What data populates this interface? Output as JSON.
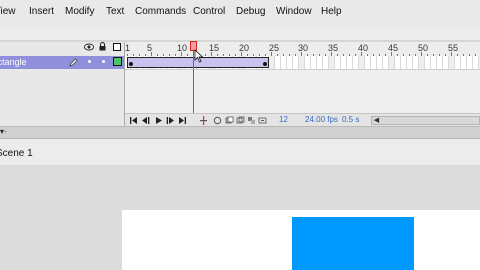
{
  "menu": [
    "View",
    "Insert",
    "Modify",
    "Text",
    "Commands",
    "Control",
    "Debug",
    "Window",
    "Help"
  ],
  "timeline": {
    "ruler_ticks": [
      "1",
      "5",
      "10",
      "15",
      "20",
      "25",
      "30",
      "35",
      "40",
      "45",
      "50",
      "55"
    ],
    "layer_name": "Rectangle",
    "current_frame": "12",
    "fps": "24.00 fps",
    "elapsed": "0.5 s",
    "tween_color": "#c7c2ee",
    "playhead_color": "#e03a3a"
  },
  "stage": {
    "scene_label": "Scene 1",
    "shape_color": "#0099ff"
  }
}
